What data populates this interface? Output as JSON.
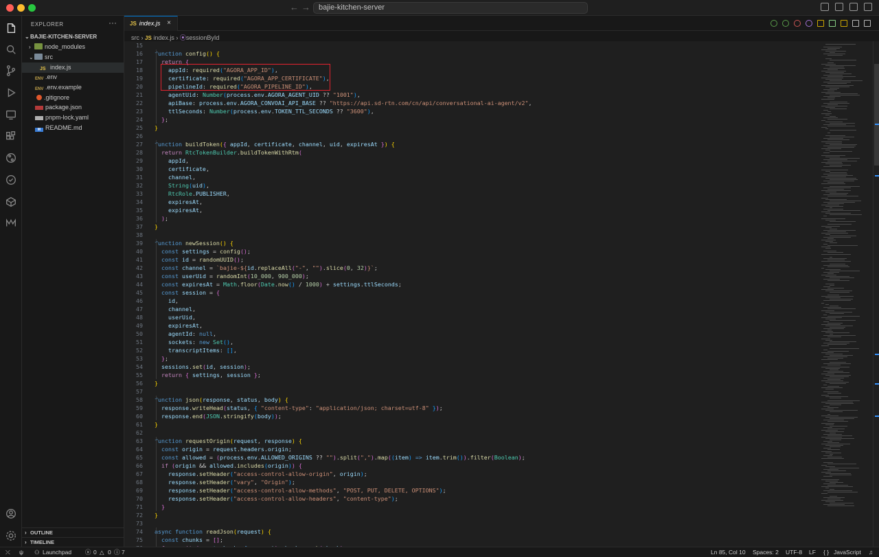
{
  "window": {
    "search_text": "bajie-kitchen-server",
    "nav_back": "←",
    "nav_forward": "→"
  },
  "sidebar": {
    "title": "EXPLORER",
    "more": "···",
    "project": "BAJIE-KITCHEN-SERVER",
    "items": [
      {
        "label": "node_modules",
        "icon": "folder-icon"
      },
      {
        "label": "src",
        "icon": "folder-icon"
      },
      {
        "label": "index.js",
        "icon": "js-file-icon"
      },
      {
        "label": ".env",
        "icon": "env-file-icon"
      },
      {
        "label": ".env.example",
        "icon": "env-file-icon"
      },
      {
        "label": ".gitignore",
        "icon": "git-icon"
      },
      {
        "label": "package.json",
        "icon": "npm-icon"
      },
      {
        "label": "pnpm-lock.yaml",
        "icon": "yaml-icon"
      },
      {
        "label": "README.md",
        "icon": "markdown-icon"
      }
    ],
    "outline": "OUTLINE",
    "timeline": "TIMELINE"
  },
  "tab": {
    "js_badge": "JS",
    "name": "index.js",
    "close": "×"
  },
  "breadcrumb": {
    "folder": "src",
    "sep1": "›",
    "js_badge": "JS",
    "file": "index.js",
    "sep2": "›",
    "symbol_icon": "⦿",
    "symbol": "sessionById"
  },
  "code": {
    "lines": [
      {
        "n": "15",
        "html": ""
      },
      {
        "n": "16",
        "html": "<span class='k'>function</span> <span class='f'>config</span><span class='b1'>()</span> <span class='b1'>{</span>"
      },
      {
        "n": "17",
        "html": "  <span class='kw'>return</span> <span class='b2'>{</span>"
      },
      {
        "n": "18",
        "html": "    <span class='v'>appId</span>: <span class='f'>required</span><span class='b3'>(</span><span class='s'>\"AGORA_APP_ID\"</span><span class='b3'>)</span>,"
      },
      {
        "n": "19",
        "html": "    <span class='v'>certificate</span>: <span class='f'>required</span><span class='b3'>(</span><span class='s'>\"AGORA_APP_CERTIFICATE\"</span><span class='b3'>)</span>,"
      },
      {
        "n": "20",
        "html": "    <span class='v'>pipelineId</span>: <span class='f'>required</span><span class='b3'>(</span><span class='s'>\"AGORA_PIPELINE_ID\"</span><span class='b3'>)</span>,"
      },
      {
        "n": "21",
        "html": "    <span class='v'>agentUid</span>: <span class='c'>Number</span><span class='b3'>(</span><span class='v'>process</span>.<span class='v'>env</span>.<span class='v'>AGORA_AGENT_UID</span> ?? <span class='s'>\"1001\"</span><span class='b3'>)</span>,"
      },
      {
        "n": "22",
        "html": "    <span class='v'>apiBase</span>: <span class='v'>process</span>.<span class='v'>env</span>.<span class='v'>AGORA_CONVOAI_API_BASE</span> ?? <span class='s'>\"https://api.sd-rtn.com/cn/api/conversational-ai-agent/v2\"</span>,"
      },
      {
        "n": "23",
        "html": "    <span class='v'>ttlSeconds</span>: <span class='c'>Number</span><span class='b3'>(</span><span class='v'>process</span>.<span class='v'>env</span>.<span class='v'>TOKEN_TTL_SECONDS</span> ?? <span class='s'>\"3600\"</span><span class='b3'>)</span>,"
      },
      {
        "n": "24",
        "html": "  <span class='b2'>}</span>;"
      },
      {
        "n": "25",
        "html": "<span class='b1'>}</span>"
      },
      {
        "n": "26",
        "html": ""
      },
      {
        "n": "27",
        "html": "<span class='k'>function</span> <span class='f'>buildToken</span><span class='b1'>(</span><span class='b2'>{</span> <span class='v'>appId</span>, <span class='v'>certificate</span>, <span class='v'>channel</span>, <span class='v'>uid</span>, <span class='v'>expiresAt</span> <span class='b2'>}</span><span class='b1'>)</span> <span class='b1'>{</span>"
      },
      {
        "n": "28",
        "html": "  <span class='kw'>return</span> <span class='c'>RtcTokenBuilder</span>.<span class='f'>buildTokenWithRtm</span><span class='b2'>(</span>"
      },
      {
        "n": "29",
        "html": "    <span class='v'>appId</span>,"
      },
      {
        "n": "30",
        "html": "    <span class='v'>certificate</span>,"
      },
      {
        "n": "31",
        "html": "    <span class='v'>channel</span>,"
      },
      {
        "n": "32",
        "html": "    <span class='c'>String</span><span class='b3'>(</span><span class='v'>uid</span><span class='b3'>)</span>,"
      },
      {
        "n": "33",
        "html": "    <span class='c'>RtcRole</span>.<span class='v'>PUBLISHER</span>,"
      },
      {
        "n": "34",
        "html": "    <span class='v'>expiresAt</span>,"
      },
      {
        "n": "35",
        "html": "    <span class='v'>expiresAt</span>,"
      },
      {
        "n": "36",
        "html": "  <span class='b2'>)</span>;"
      },
      {
        "n": "37",
        "html": "<span class='b1'>}</span>"
      },
      {
        "n": "38",
        "html": ""
      },
      {
        "n": "39",
        "html": "<span class='k'>function</span> <span class='f'>newSession</span><span class='b1'>()</span> <span class='b1'>{</span>"
      },
      {
        "n": "40",
        "html": "  <span class='k'>const</span> <span class='v'>settings</span> = <span class='f'>config</span><span class='b2'>()</span>;"
      },
      {
        "n": "41",
        "html": "  <span class='k'>const</span> <span class='v'>id</span> = <span class='f'>randomUUID</span><span class='b2'>()</span>;"
      },
      {
        "n": "42",
        "html": "  <span class='k'>const</span> <span class='v'>channel</span> = <span class='s'>`bajie-${</span><span class='v'>id</span>.<span class='f'>replaceAll</span><span class='b2'>(</span><span class='s'>\"-\"</span>, <span class='s'>\"\"</span><span class='b2'>)</span>.<span class='f'>slice</span><span class='b2'>(</span><span class='n'>0</span>, <span class='n'>32</span><span class='b2'>)</span><span class='s'>}`</span>;"
      },
      {
        "n": "43",
        "html": "  <span class='k'>const</span> <span class='v'>userUid</span> = <span class='f'>randomInt</span><span class='b2'>(</span><span class='n'>10_000</span>, <span class='n'>900_000</span><span class='b2'>)</span>;"
      },
      {
        "n": "44",
        "html": "  <span class='k'>const</span> <span class='v'>expiresAt</span> = <span class='c'>Math</span>.<span class='f'>floor</span><span class='b2'>(</span><span class='c'>Date</span>.<span class='f'>now</span><span class='b3'>()</span> / <span class='n'>1000</span><span class='b2'>)</span> + <span class='v'>settings</span>.<span class='v'>ttlSeconds</span>;"
      },
      {
        "n": "45",
        "html": "  <span class='k'>const</span> <span class='v'>session</span> = <span class='b2'>{</span>"
      },
      {
        "n": "46",
        "html": "    <span class='v'>id</span>,"
      },
      {
        "n": "47",
        "html": "    <span class='v'>channel</span>,"
      },
      {
        "n": "48",
        "html": "    <span class='v'>userUid</span>,"
      },
      {
        "n": "49",
        "html": "    <span class='v'>expiresAt</span>,"
      },
      {
        "n": "50",
        "html": "    <span class='v'>agentId</span>: <span class='k'>null</span>,"
      },
      {
        "n": "51",
        "html": "    <span class='v'>sockets</span>: <span class='k'>new</span> <span class='c'>Set</span><span class='b3'>()</span>,"
      },
      {
        "n": "52",
        "html": "    <span class='v'>transcriptItems</span>: <span class='b3'>[]</span>,"
      },
      {
        "n": "53",
        "html": "  <span class='b2'>}</span>;"
      },
      {
        "n": "54",
        "html": "  <span class='v'>sessions</span>.<span class='f'>set</span><span class='b2'>(</span><span class='v'>id</span>, <span class='v'>session</span><span class='b2'>)</span>;"
      },
      {
        "n": "55",
        "html": "  <span class='kw'>return</span> <span class='b2'>{</span> <span class='v'>settings</span>, <span class='v'>session</span> <span class='b2'>}</span>;"
      },
      {
        "n": "56",
        "html": "<span class='b1'>}</span>"
      },
      {
        "n": "57",
        "html": ""
      },
      {
        "n": "58",
        "html": "<span class='k'>function</span> <span class='f'>json</span><span class='b1'>(</span><span class='v'>response</span>, <span class='v'>status</span>, <span class='v'>body</span><span class='b1'>)</span> <span class='b1'>{</span>"
      },
      {
        "n": "59",
        "html": "  <span class='v'>response</span>.<span class='f'>writeHead</span><span class='b2'>(</span><span class='v'>status</span>, <span class='b3'>{</span> <span class='s'>\"content-type\"</span>: <span class='s'>\"application/json; charset=utf-8\"</span> <span class='b3'>}</span><span class='b2'>)</span>;"
      },
      {
        "n": "60",
        "html": "  <span class='v'>response</span>.<span class='f'>end</span><span class='b2'>(</span><span class='c'>JSON</span>.<span class='f'>stringify</span><span class='b3'>(</span><span class='v'>body</span><span class='b3'>)</span><span class='b2'>)</span>;"
      },
      {
        "n": "61",
        "html": "<span class='b1'>}</span>"
      },
      {
        "n": "62",
        "html": ""
      },
      {
        "n": "63",
        "html": "<span class='k'>function</span> <span class='f'>requestOrigin</span><span class='b1'>(</span><span class='v'>request</span>, <span class='v'>response</span><span class='b1'>)</span> <span class='b1'>{</span>"
      },
      {
        "n": "64",
        "html": "  <span class='k'>const</span> <span class='v'>origin</span> = <span class='v'>request</span>.<span class='v'>headers</span>.<span class='v'>origin</span>;"
      },
      {
        "n": "65",
        "html": "  <span class='k'>const</span> <span class='v'>allowed</span> = <span class='b2'>(</span><span class='v'>process</span>.<span class='v'>env</span>.<span class='v'>ALLOWED_ORIGINS</span> ?? <span class='s'>\"\"</span><span class='b2'>)</span>.<span class='f'>split</span><span class='b2'>(</span><span class='s'>\",\"</span><span class='b2'>)</span>.<span class='f'>map</span><span class='b2'>(</span><span class='b3'>(</span><span class='v'>item</span><span class='b3'>)</span> <span class='k'>=&gt;</span> <span class='v'>item</span>.<span class='f'>trim</span><span class='b3'>()</span><span class='b2'>)</span>.<span class='f'>filter</span><span class='b2'>(</span><span class='c'>Boolean</span><span class='b2'>)</span>;"
      },
      {
        "n": "66",
        "html": "  <span class='kw'>if</span> <span class='b2'>(</span><span class='v'>origin</span> &amp;&amp; <span class='v'>allowed</span>.<span class='f'>includes</span><span class='b3'>(</span><span class='v'>origin</span><span class='b3'>)</span><span class='b2'>)</span> <span class='b2'>{</span>"
      },
      {
        "n": "67",
        "html": "    <span class='v'>response</span>.<span class='f'>setHeader</span><span class='b3'>(</span><span class='s'>\"access-control-allow-origin\"</span>, <span class='v'>origin</span><span class='b3'>)</span>;"
      },
      {
        "n": "68",
        "html": "    <span class='v'>response</span>.<span class='f'>setHeader</span><span class='b3'>(</span><span class='s'>\"vary\"</span>, <span class='s'>\"Origin\"</span><span class='b3'>)</span>;"
      },
      {
        "n": "69",
        "html": "    <span class='v'>response</span>.<span class='f'>setHeader</span><span class='b3'>(</span><span class='s'>\"access-control-allow-methods\"</span>, <span class='s'>\"POST, PUT, DELETE, OPTIONS\"</span><span class='b3'>)</span>;"
      },
      {
        "n": "70",
        "html": "    <span class='v'>response</span>.<span class='f'>setHeader</span><span class='b3'>(</span><span class='s'>\"access-control-allow-headers\"</span>, <span class='s'>\"content-type\"</span><span class='b3'>)</span>;"
      },
      {
        "n": "71",
        "html": "  <span class='b2'>}</span>"
      },
      {
        "n": "72",
        "html": "<span class='b1'>}</span>"
      },
      {
        "n": "73",
        "html": ""
      },
      {
        "n": "74",
        "html": "<span class='k'>async</span> <span class='k'>function</span> <span class='f'>readJson</span><span class='b1'>(</span><span class='v'>request</span><span class='b1'>)</span> <span class='b1'>{</span>"
      },
      {
        "n": "75",
        "html": "  <span class='k'>const</span> <span class='v'>chunks</span> = <span class='b2'>[]</span>;"
      },
      {
        "n": "76",
        "html": "  <span class='kw'>for</span> <span class='kw'>await</span> <span class='b2'>(</span><span class='k'>const</span> <span class='v'>chunk</span> <span class='k'>of</span> <span class='v'>request</span><span class='b2'>)</span> <span class='v'>chunks</span>.<span class='f'>push</span><span class='b2'>(</span><span class='v'>chunk</span><span class='b2'>)</span>;"
      }
    ]
  },
  "status": {
    "launchpad": "Launchpad",
    "errors": "0",
    "warnings": "0",
    "info": "7",
    "position": "Ln 85, Col 10",
    "spaces": "Spaces: 2",
    "encoding": "UTF-8",
    "eol": "LF",
    "language_braces": "{ }",
    "language": "JavaScript"
  },
  "colors": {
    "accent": "#0078d4",
    "highlight_box": "#e5222f"
  }
}
